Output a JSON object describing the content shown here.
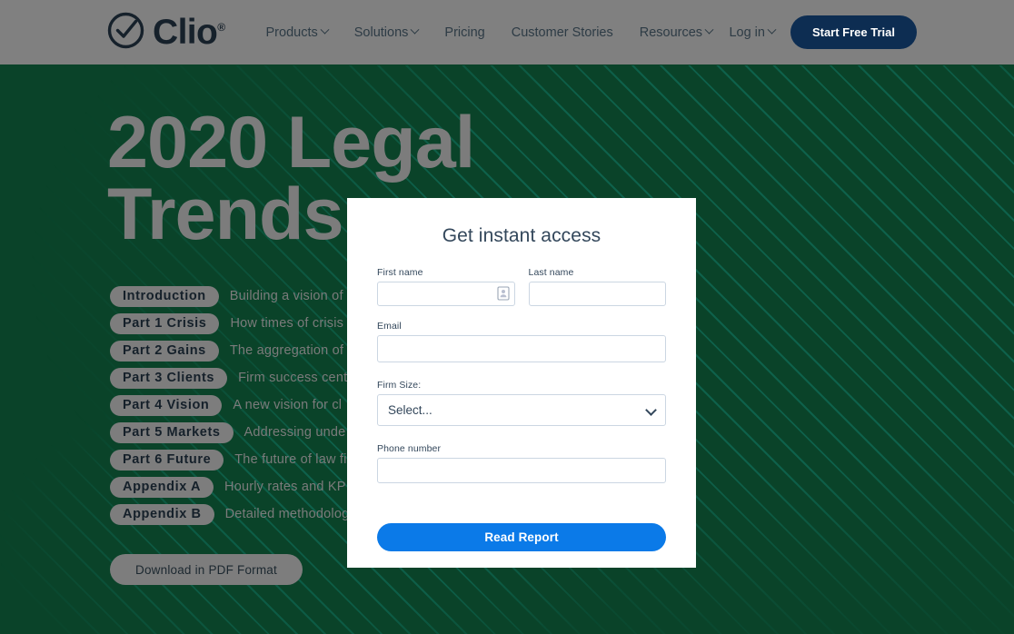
{
  "nav": {
    "logo_text": "Clio",
    "logo_tm": "®",
    "logo_icon": "check-circle-icon",
    "links": [
      {
        "label": "Products",
        "has_caret": true
      },
      {
        "label": "Solutions",
        "has_caret": true
      },
      {
        "label": "Pricing",
        "has_caret": false
      },
      {
        "label": "Customer Stories",
        "has_caret": false
      },
      {
        "label": "Resources",
        "has_caret": true
      }
    ],
    "login_label": "Log in",
    "trial_label": "Start Free Trial"
  },
  "hero": {
    "title": "2020 Legal Trends",
    "title_line1": "2020 Legal",
    "title_line2": "Trends",
    "pdf_button": "Download in PDF Format",
    "toc": [
      {
        "pill": "Introduction",
        "desc": "Building a vision of"
      },
      {
        "pill": "Part 1  Crisis",
        "desc": "How times of crisis"
      },
      {
        "pill": "Part 2  Gains",
        "desc": "The aggregation of"
      },
      {
        "pill": "Part 3  Clients",
        "desc": "Firm success cente"
      },
      {
        "pill": "Part 4  Vision",
        "desc": "A new vision for cl"
      },
      {
        "pill": "Part 5  Markets",
        "desc": "Addressing unde"
      },
      {
        "pill": "Part 6  Future",
        "desc": "The future of law fi"
      },
      {
        "pill": "Appendix A",
        "desc": "Hourly rates and KP"
      },
      {
        "pill": "Appendix B",
        "desc": "Detailed methodolog"
      }
    ]
  },
  "modal": {
    "title": "Get instant access",
    "first_name": {
      "label": "First name",
      "value": "",
      "placeholder": ""
    },
    "last_name": {
      "label": "Last name",
      "value": "",
      "placeholder": ""
    },
    "email": {
      "label": "Email",
      "value": "",
      "placeholder": ""
    },
    "firm_size": {
      "label": "Firm Size:",
      "selected": "Select...",
      "options": [
        "Select..."
      ]
    },
    "phone": {
      "label": "Phone number",
      "value": "",
      "placeholder": ""
    },
    "submit_label": "Read Report"
  },
  "colors": {
    "hero_green": "#0a4329",
    "stripe_teal": "#127a68",
    "nav_grey": "#808080",
    "navy": "#0d2d52",
    "accent_blue": "#0b7ae8",
    "pill_grey": "#7d7d7d",
    "hero_text_grey": "#7c7c7c",
    "form_text": "#33475b",
    "input_border": "#cbd6e2"
  }
}
